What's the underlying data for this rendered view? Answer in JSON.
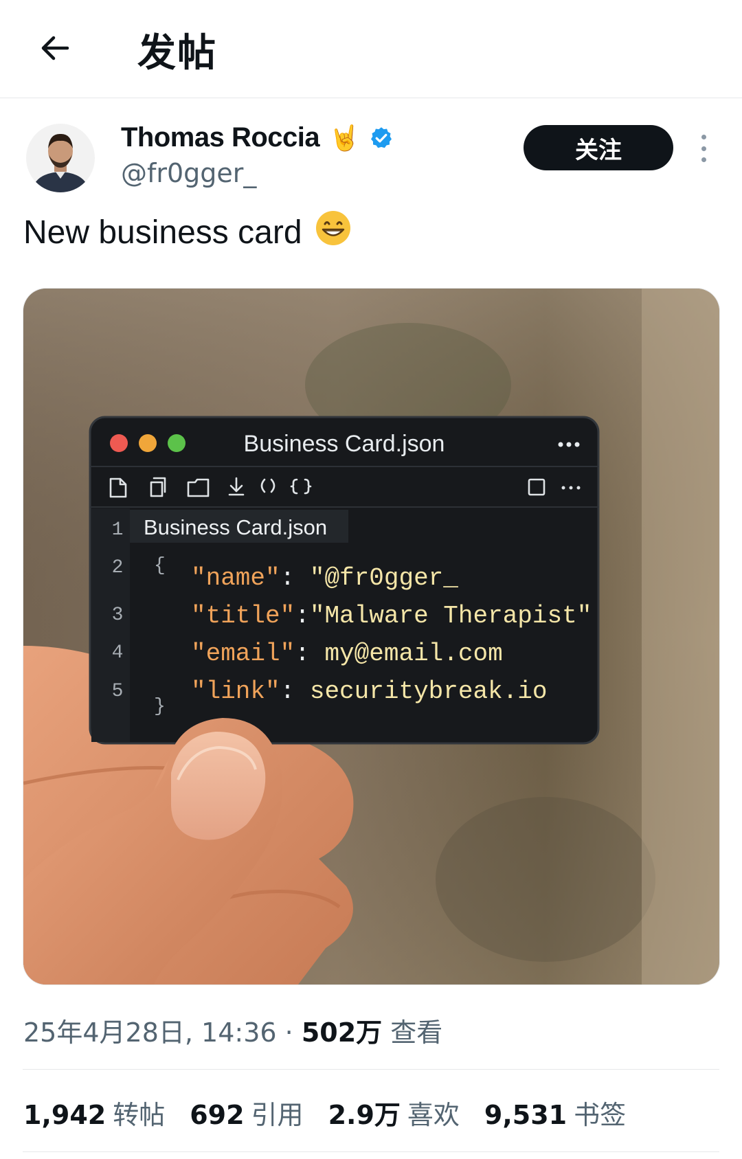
{
  "header": {
    "title": "发帖"
  },
  "author": {
    "name": "Thomas Roccia",
    "handle": "@fr0gger_",
    "emoji": "🤘",
    "follow_label": "关注"
  },
  "post": {
    "text": "New business card",
    "emoji": "😁"
  },
  "card": {
    "window_title": "Business Card.json",
    "tab_label": "Business Card.json",
    "line_numbers": [
      "1",
      "2",
      "3",
      "4",
      "5"
    ],
    "open_brace": "{",
    "close_brace": "}",
    "lines": [
      {
        "key": "\"name\"",
        "sep": ": ",
        "value": "\"@fr0gger_"
      },
      {
        "key": "\"title\"",
        "sep": ":",
        "value": "\"Malware Therapist\""
      },
      {
        "key": "\"email\"",
        "sep": ": ",
        "value": "my@email.com"
      },
      {
        "key": "\"link\"",
        "sep": ": ",
        "value": "securitybreak.io"
      }
    ]
  },
  "meta": {
    "date": "25年4月28日, 14:36",
    "dot": " · ",
    "views_count": "502万",
    "views_label": "查看"
  },
  "stats": [
    {
      "count": "1,942",
      "label": "转帖"
    },
    {
      "count": "692",
      "label": "引用"
    },
    {
      "count": "2.9万",
      "label": "喜欢"
    },
    {
      "count": "9,531",
      "label": "书签"
    }
  ],
  "colors": {
    "follow_bg": "#0f1419",
    "verified": "#1d9bf0",
    "secondary_text": "#536471",
    "code_key": "#f0a35a",
    "code_value": "#f5e6a8"
  },
  "icons": [
    "back-arrow-icon",
    "verified-badge-icon",
    "more-vertical-icon"
  ]
}
